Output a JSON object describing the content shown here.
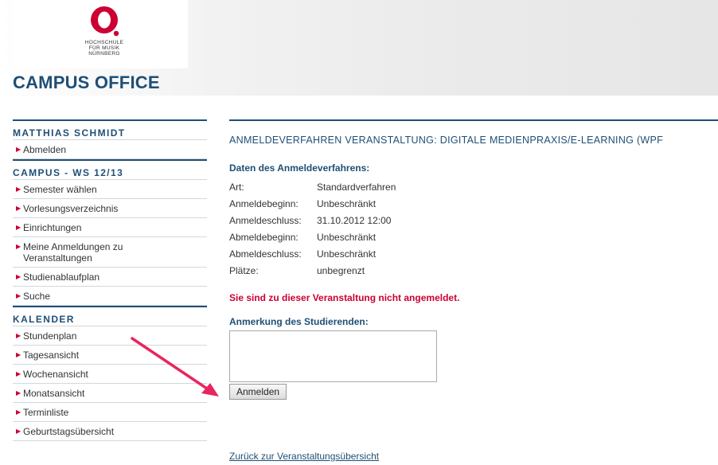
{
  "header": {
    "logo_text_lines": [
      "HOCHSCHULE",
      "FÜR MUSIK",
      "NÜRNBERG"
    ],
    "campus_title": "CAMPUS OFFICE"
  },
  "sidebar": {
    "user": {
      "heading": "MATTHIAS SCHMIDT",
      "items": [
        {
          "label": "Abmelden"
        }
      ]
    },
    "campus": {
      "heading": "CAMPUS - WS 12/13",
      "items": [
        {
          "label": "Semester wählen"
        },
        {
          "label": "Vorlesungsverzeichnis"
        },
        {
          "label": "Einrichtungen"
        },
        {
          "label": "Meine Anmeldungen zu Veranstaltungen"
        },
        {
          "label": "Studienablaufplan"
        },
        {
          "label": "Suche"
        }
      ]
    },
    "calendar": {
      "heading": "KALENDER",
      "items": [
        {
          "label": "Stundenplan"
        },
        {
          "label": "Tagesansicht"
        },
        {
          "label": "Wochenansicht"
        },
        {
          "label": "Monatsansicht"
        },
        {
          "label": "Terminliste"
        },
        {
          "label": "Geburtstagsübersicht"
        }
      ]
    }
  },
  "main": {
    "title": "ANMELDEVERFAHREN VERANSTALTUNG: DIGITALE MEDIENPRAXIS/E-LEARNING (WPF",
    "section_heading": "Daten des Anmeldeverfahrens:",
    "info": [
      {
        "key": "Art:",
        "value": "Standardverfahren"
      },
      {
        "key": "Anmeldebeginn:",
        "value": "Unbeschränkt"
      },
      {
        "key": "Anmeldeschluss:",
        "value": "31.10.2012 12:00"
      },
      {
        "key": "Abmeldebeginn:",
        "value": "Unbeschränkt"
      },
      {
        "key": "Abmeldeschluss:",
        "value": "Unbeschränkt"
      },
      {
        "key": "Plätze:",
        "value": "unbegrenzt"
      }
    ],
    "status_message": "Sie sind zu dieser Veranstaltung nicht angemeldet.",
    "remark_heading": "Anmerkung des Studierenden:",
    "remark_value": "",
    "submit_label": "Anmelden",
    "back_link": "Zurück zur Veranstaltungsübersicht"
  },
  "colors": {
    "brand_blue": "#1f4f76",
    "accent_red": "#cc0033",
    "annotation_arrow": "#e8265e"
  },
  "icons": {
    "menu_bullet": "triangle-right-icon",
    "annotation": "arrow-annotation-icon"
  }
}
